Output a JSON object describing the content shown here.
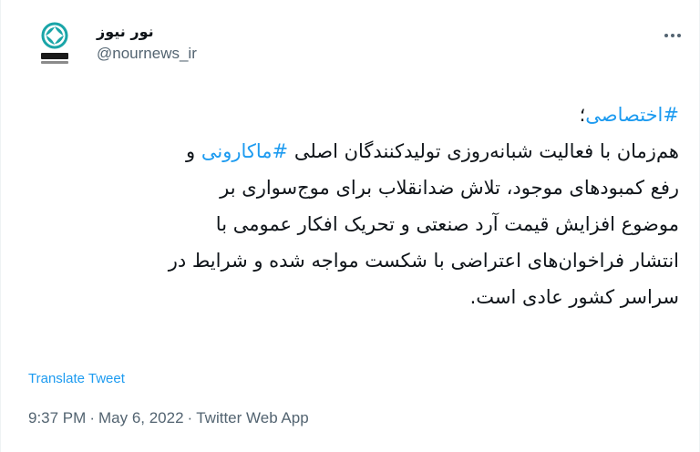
{
  "author": {
    "display_name": "نور نیوز",
    "handle": "@nournews_ir",
    "avatar_icon": "nournews-logo-icon",
    "avatar_logo_text": "نورنیوز",
    "avatar_logo_subtext": "nournews"
  },
  "tweet": {
    "line1": {
      "hashtag": "#اختصاصی",
      "suffix": "؛"
    },
    "line2": {
      "before": "هم‌زمان با فعالیت شبانه‌روزی تولیدکنندگان اصلی ",
      "hashtag": "#ماکارونی",
      "after": " و"
    },
    "line3": "رفع کمبودهای موجود، تلاش ضدانقلاب برای موج‌سواری بر",
    "line4": "موضوع افزایش قیمت آرد صنعتی و تحریک افکار عمومی با",
    "line5": "انتشار فراخوان‌های اعتراضی با شکست مواجه شده و شرایط در",
    "line6": "سراسر کشور عادی است."
  },
  "translate_label": "Translate Tweet",
  "meta": {
    "time": "9:37 PM",
    "date": "May 6, 2022",
    "source": "Twitter Web App",
    "separator": "·"
  },
  "more_icon": "more-options-icon",
  "colors": {
    "link": "#1d9bf0",
    "text": "#0f1419",
    "secondary": "#536471",
    "logo_teal": "#1aa5a8"
  }
}
